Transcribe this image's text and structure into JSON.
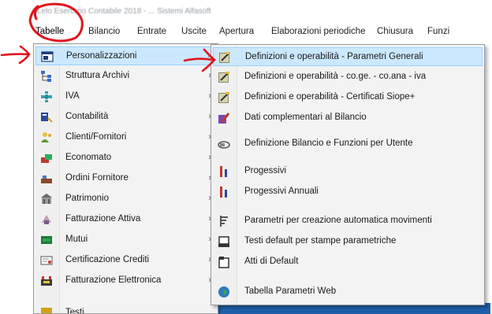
{
  "window": {
    "title": "Lelo Esercizio Contabile 2018 - ...   Sistemi Alfasoft"
  },
  "menubar": {
    "items": [
      {
        "label": "Tabelle",
        "active": true
      },
      {
        "label": "Bilancio"
      },
      {
        "label": "Entrate"
      },
      {
        "label": "Uscite"
      },
      {
        "label": "Apertura"
      },
      {
        "label": "Elaborazioni periodiche"
      },
      {
        "label": "Chiusura"
      },
      {
        "label": "Funzi"
      }
    ]
  },
  "tabelle_menu": {
    "items": [
      {
        "label": "Personalizzazioni",
        "icon": "window-icon",
        "submenu": true,
        "highlighted": true
      },
      {
        "label": "Struttura Archivi",
        "icon": "tree-structure-icon",
        "submenu": true
      },
      {
        "label": "IVA",
        "icon": "network-icon",
        "submenu": true
      },
      {
        "label": "Contabilità",
        "icon": "accounting-icon",
        "submenu": true
      },
      {
        "label": "Clienti/Fornitori",
        "icon": "people-icon",
        "submenu": true
      },
      {
        "label": "Economato",
        "icon": "economato-icon",
        "submenu": true
      },
      {
        "label": "Ordini Fornitore",
        "icon": "order-icon",
        "submenu": true
      },
      {
        "label": "Patrimonio",
        "icon": "building-icon",
        "submenu": true
      },
      {
        "label": "Fatturazione Attiva",
        "icon": "invoice-icon",
        "submenu": true
      },
      {
        "label": "Mutui",
        "icon": "loan-icon",
        "submenu": true
      },
      {
        "label": "Certificazione Crediti",
        "icon": "certificate-icon",
        "submenu": true
      },
      {
        "label": "Fatturazione Elettronica",
        "icon": "e-invoice-icon",
        "submenu": true
      },
      {
        "label": "Testi",
        "icon": "text-icon",
        "submenu": true
      }
    ]
  },
  "personalizzazioni_submenu": {
    "items": [
      {
        "label": "Definizioni e operabilità - Parametri Generali",
        "icon": "edit-settings-icon",
        "highlighted": true
      },
      {
        "label": "Definizioni e operabilità - co.ge. - co.ana - iva",
        "icon": "edit-settings-icon"
      },
      {
        "label": "Definizioni e operabilità - Certificati Siope+",
        "icon": "edit-settings-icon"
      },
      {
        "label": "Dati complementari al Bilancio",
        "icon": "pencil-book-icon"
      },
      {
        "label": "Definizione Bilancio e Funzioni per Utente",
        "icon": "user-function-icon"
      },
      {
        "label": "Progessivi",
        "icon": "progressive-icon"
      },
      {
        "label": "Progessivi Annuali",
        "icon": "progressive-icon"
      },
      {
        "label": "Parametri per creazione automatica movimenti",
        "icon": "parameters-icon"
      },
      {
        "label": "Testi default per stampe parametriche",
        "icon": "printer-icon"
      },
      {
        "label": "Atti di Default",
        "icon": "document-icon"
      },
      {
        "label": "Tabella Parametri Web",
        "icon": "globe-icon"
      }
    ]
  },
  "colors": {
    "highlight_bg": "#cce8ff",
    "highlight_border": "#99d1ff",
    "menu_bg": "#f3f3f3",
    "annotation_red": "#e0141e"
  }
}
